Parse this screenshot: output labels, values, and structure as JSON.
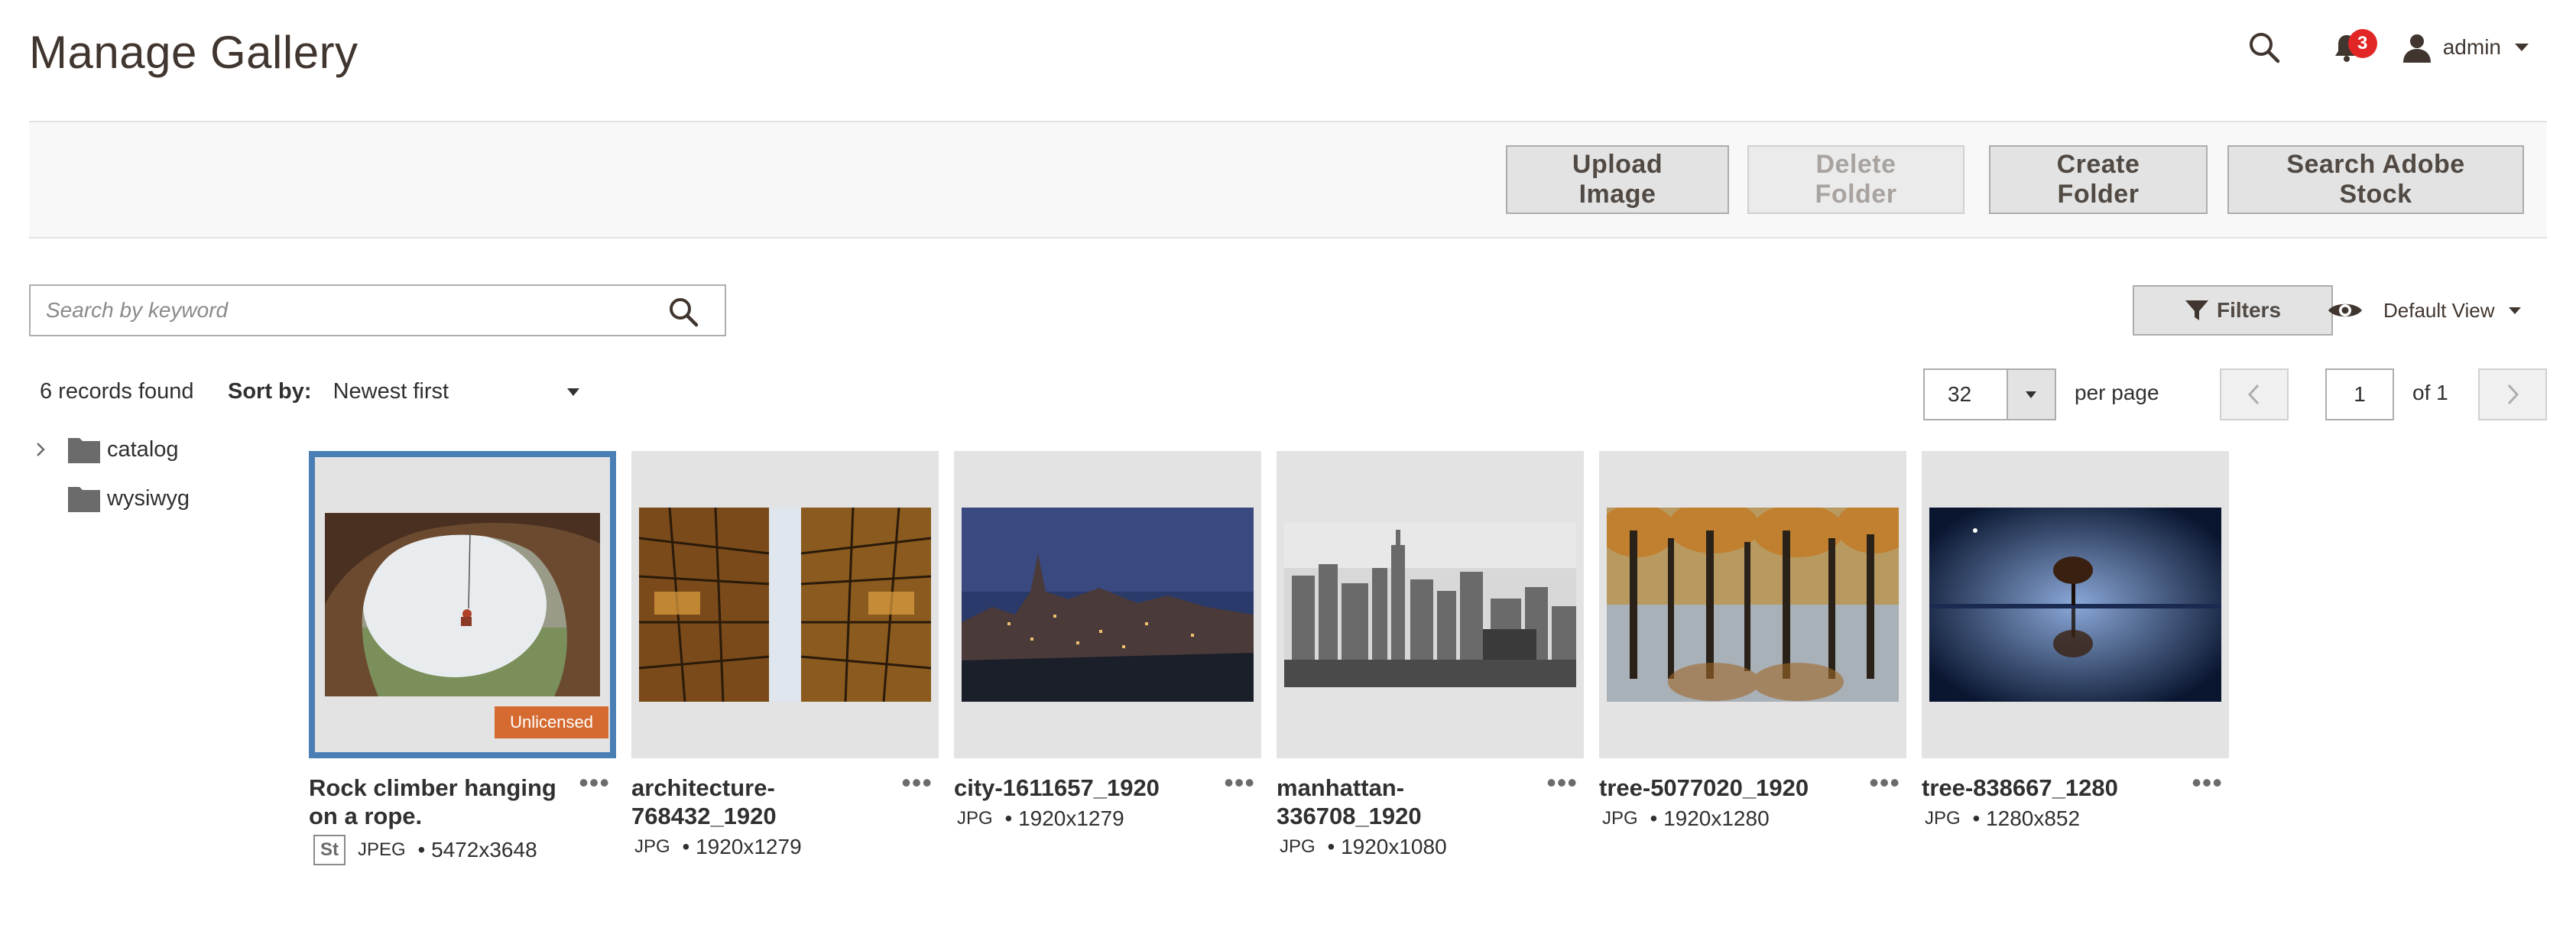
{
  "header": {
    "title": "Manage Gallery",
    "notifications_count": "3",
    "user_name": "admin"
  },
  "actions": {
    "upload_image": "Upload Image",
    "delete_folder": "Delete Folder",
    "create_folder": "Create Folder",
    "search_adobe_stock": "Search Adobe Stock"
  },
  "search": {
    "placeholder": "Search by keyword",
    "value": ""
  },
  "toolbar": {
    "filters_label": "Filters",
    "view_label": "Default View",
    "records_found": "6 records found",
    "sort_label": "Sort by:",
    "sort_value": "Newest first",
    "per_page_value": "32",
    "per_page_label": "per page",
    "current_page": "1",
    "total_pages": "of 1"
  },
  "folders": [
    {
      "name": "catalog",
      "expandable": true
    },
    {
      "name": "wysiwyg",
      "expandable": false
    }
  ],
  "images": [
    {
      "title": "Rock climber hanging on a rope.",
      "format": "JPEG",
      "dimensions": "5472x3648",
      "stock_badge": "St",
      "badge": "Unlicensed",
      "selected": true,
      "scene": "cave"
    },
    {
      "title": "architecture-768432_1920",
      "format": "JPG",
      "dimensions": "1920x1279",
      "scene": "architecture"
    },
    {
      "title": "city-1611657_1920",
      "format": "JPG",
      "dimensions": "1920x1279",
      "scene": "city-night"
    },
    {
      "title": "manhattan-336708_1920",
      "format": "JPG",
      "dimensions": "1920x1080",
      "scene": "manhattan"
    },
    {
      "title": "tree-5077020_1920",
      "format": "JPG",
      "dimensions": "1920x1280",
      "scene": "trees-reflection"
    },
    {
      "title": "tree-838667_1280",
      "format": "JPG",
      "dimensions": "1280x852",
      "scene": "tree-night"
    }
  ],
  "colors": {
    "accent_selected": "#4a7fb5",
    "badge_unlicensed": "#d56b31",
    "notification": "#e22626",
    "button_bg": "#e3e3e3",
    "text_dark": "#41362f"
  },
  "icons": {
    "search": "search-icon",
    "bell": "bell-icon",
    "user": "user-icon",
    "filter": "filter-icon",
    "eye": "eye-icon",
    "folder": "folder-icon",
    "more": "more-options-icon"
  }
}
